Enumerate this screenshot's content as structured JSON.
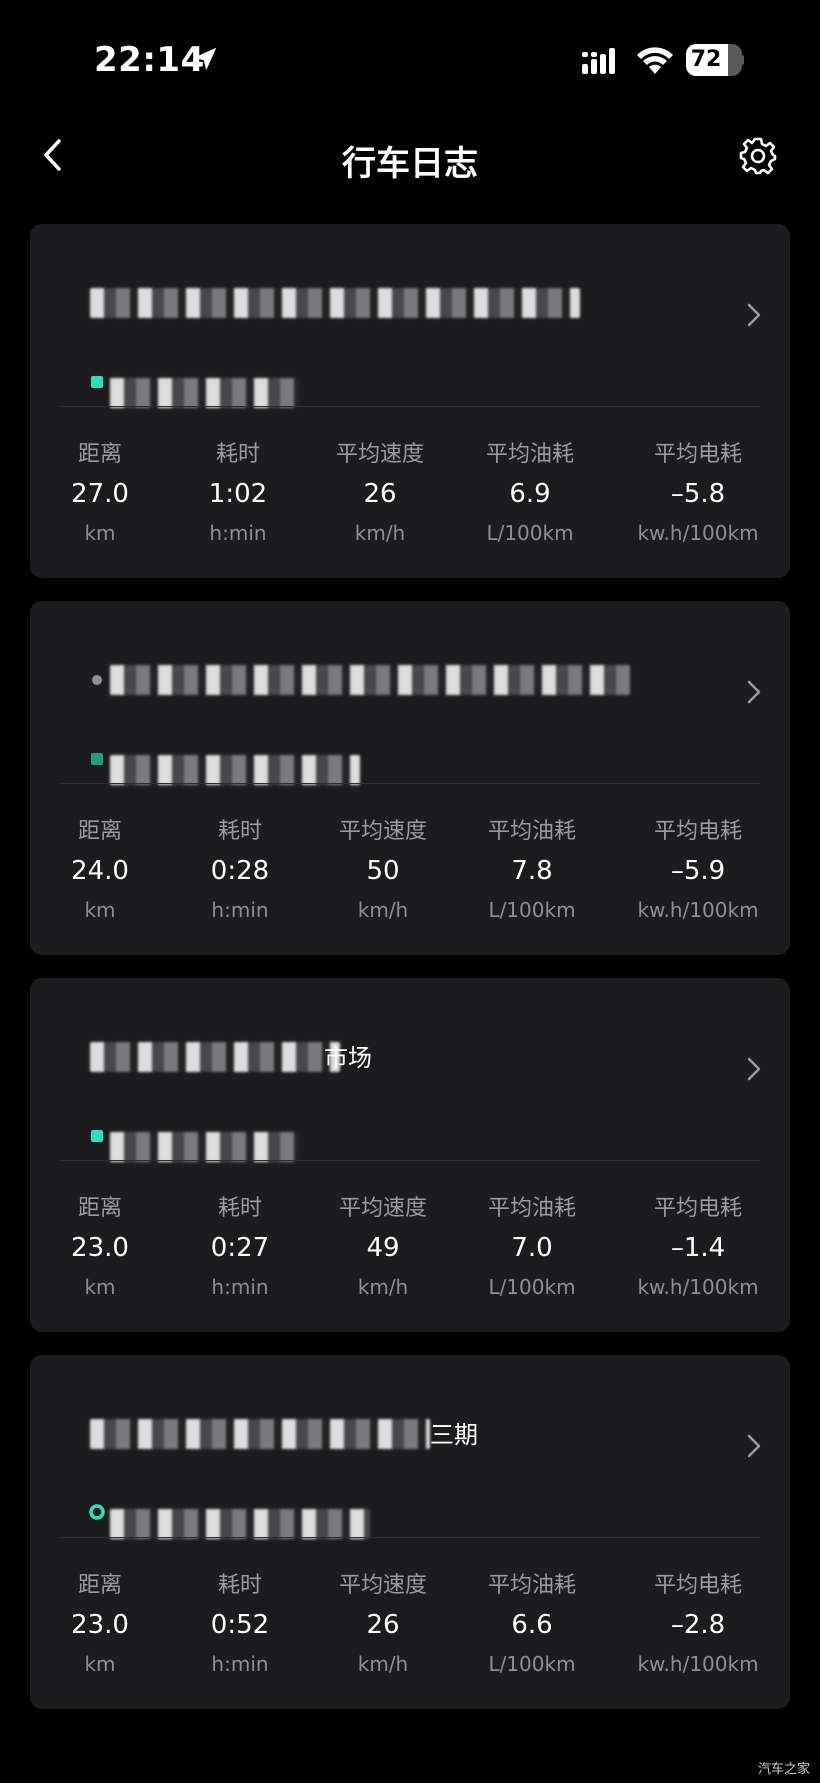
{
  "status_bar": {
    "time": "22:14",
    "battery": "72",
    "icons": [
      "location-arrow-icon",
      "cellular-signal-icon",
      "wifi-icon",
      "battery-icon"
    ]
  },
  "nav": {
    "title": "行车日志",
    "back_icon": "chevron-left-icon",
    "settings_icon": "gear-icon"
  },
  "stat_labels": [
    "距离",
    "耗时",
    "平均速度",
    "平均油耗",
    "平均电耗"
  ],
  "stat_units": [
    "km",
    "h:min",
    "km/h",
    "L/100km",
    "kw.h/100km"
  ],
  "trips": [
    {
      "start_text": "",
      "end_text": "",
      "values": [
        "27.0",
        "1:02",
        "26",
        "6.9",
        "–5.8"
      ]
    },
    {
      "start_text": "",
      "end_text": "",
      "values": [
        "24.0",
        "0:28",
        "50",
        "7.8",
        "–5.9"
      ]
    },
    {
      "start_text": "市场",
      "end_text": "",
      "values": [
        "23.0",
        "0:27",
        "49",
        "7.0",
        "–1.4"
      ]
    },
    {
      "start_text": "三期",
      "end_text": "",
      "values": [
        "23.0",
        "0:52",
        "26",
        "6.6",
        "–2.8"
      ]
    }
  ],
  "colors": {
    "background": "#000000",
    "card": "#1c1c1e",
    "accent": "#2ee0b5",
    "label": "#9a9aa0"
  },
  "watermark": "汽车之家"
}
